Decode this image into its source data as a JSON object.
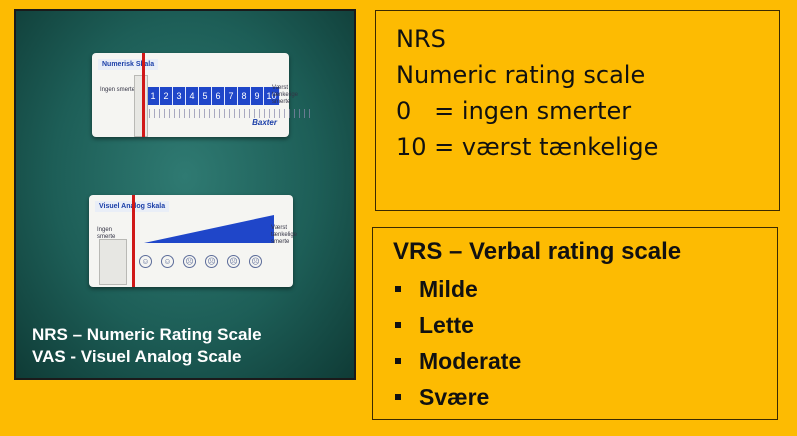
{
  "photo": {
    "nrs_card": {
      "title": "Numerisk Skala",
      "left_label": "Ingen smerte",
      "right_label": "Værst tænkelige smerte",
      "scale_numbers": [
        "1",
        "2",
        "3",
        "4",
        "5",
        "6",
        "7",
        "8",
        "9",
        "10"
      ],
      "brand": "Baxter"
    },
    "vas_card": {
      "title": "Visuel Analog Skala",
      "left_label": "Ingen smerte",
      "right_label": "Værst tænkelige smerte"
    },
    "caption": {
      "line1": "NRS – Numeric Rating Scale",
      "line2": "VAS - Visuel Analog Scale"
    }
  },
  "nrs_panel": {
    "line1": "NRS",
    "line2": "Numeric rating scale",
    "line3": "0   = ingen smerter",
    "line4": "10 = værst tænkelige"
  },
  "vrs_panel": {
    "title": "VRS – Verbal rating scale",
    "items": [
      "Milde",
      "Lette",
      "Moderate",
      "Svære"
    ]
  },
  "colors": {
    "background": "#FDBB02",
    "photo_background": "#1d5e57",
    "scale_blue": "#1f46c9",
    "marker_red": "#d01818",
    "caption_text": "#ffffff"
  }
}
